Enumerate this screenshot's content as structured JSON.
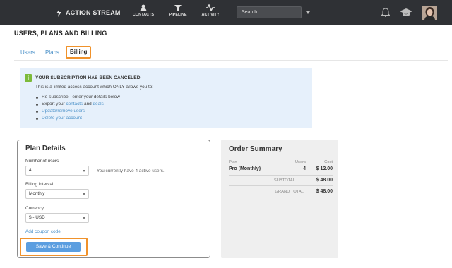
{
  "topbar": {
    "brand": "ACTION STREAM",
    "nav": [
      {
        "label": "CONTACTS",
        "icon": "person-icon"
      },
      {
        "label": "PIPELINE",
        "icon": "pipeline-icon"
      },
      {
        "label": "ACTIVITY",
        "icon": "activity-icon"
      }
    ],
    "search": {
      "placeholder": "Search",
      "value": ""
    },
    "icons": [
      "bell-icon",
      "graduation-cap-icon"
    ],
    "colors": {
      "bar": "#2f3135",
      "accent": "#f0922b",
      "link": "#4a90c8"
    }
  },
  "page": {
    "title": "USERS, PLANS AND BILLING"
  },
  "tabs": [
    {
      "label": "Users",
      "active": false
    },
    {
      "label": "Plans",
      "active": false
    },
    {
      "label": "Billing",
      "active": true
    }
  ],
  "notice": {
    "title": "YOUR SUBSCRIPTION HAS BEEN CANCELED",
    "subtitle": "This is a limited access account which ONLY allows you to:",
    "item1": "Re-subscribe - enter your details below",
    "item2_pre": "Export your ",
    "item2_link1": "contacts",
    "item2_mid": " and ",
    "item2_link2": "deals",
    "item3": "Update/remove users",
    "item4": "Delete your account"
  },
  "plan": {
    "title": "Plan Details",
    "users_label": "Number of users",
    "users_value": "4",
    "users_note": "You currently have 4 active users.",
    "interval_label": "Billing interval",
    "interval_value": "Monthly",
    "currency_label": "Currency",
    "currency_value": "$ - USD",
    "coupon": "Add coupon code",
    "save": "Save & Continue"
  },
  "order": {
    "title": "Order Summary",
    "col_plan": "Plan",
    "col_users": "Users",
    "col_cost": "Cost",
    "plan_name": "Pro (Monthly)",
    "plan_users": "4",
    "plan_cost": "$ 12.00",
    "subtotal_label": "SUBTOTAL",
    "subtotal": "$ 48.00",
    "grand_label": "GRAND TOTAL",
    "grand": "$ 48.00"
  }
}
